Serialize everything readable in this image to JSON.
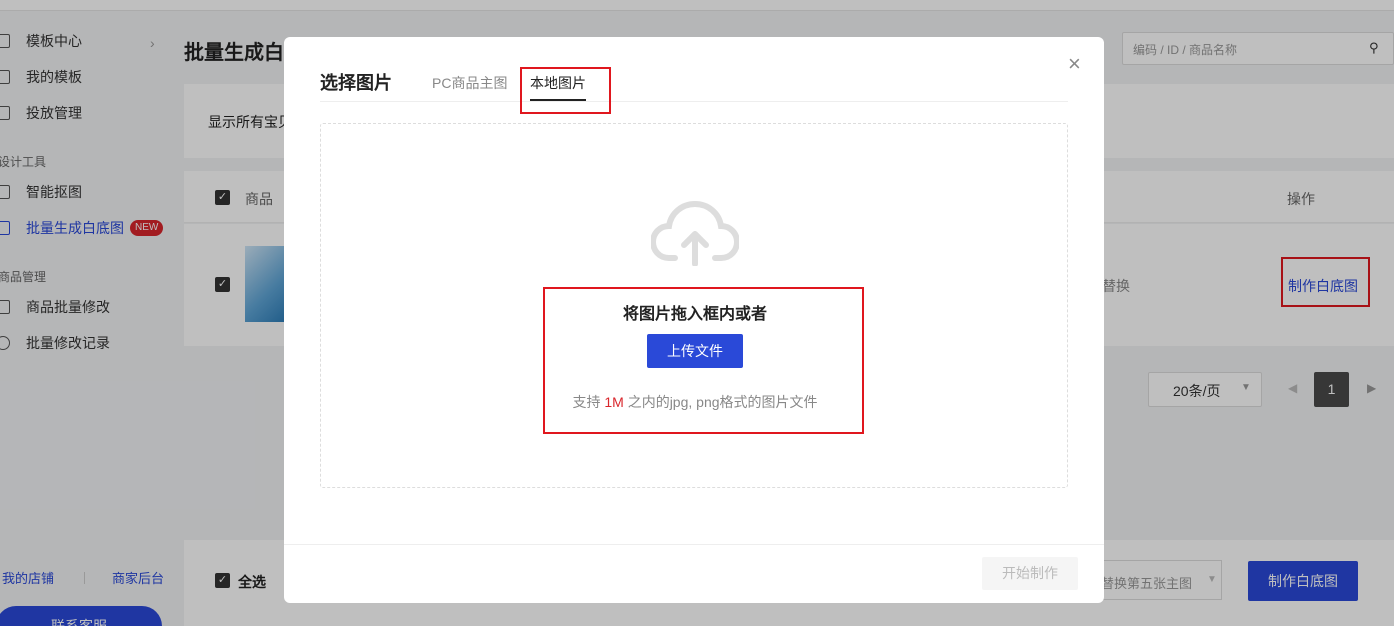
{
  "sidebar": {
    "items": [
      {
        "label": "模板中心",
        "icon": "grid-icon"
      },
      {
        "label": "我的模板",
        "icon": "folder-icon"
      },
      {
        "label": "投放管理",
        "icon": "deliver-icon"
      }
    ],
    "group_design": "设计工具",
    "design_items": [
      {
        "label": "智能抠图",
        "icon": "cutout-icon"
      },
      {
        "label": "批量生成白底图",
        "icon": "white-bg-icon",
        "badge": "NEW"
      }
    ],
    "group_goods": "商品管理",
    "goods_items": [
      {
        "label": "商品批量修改",
        "icon": "bag-icon"
      },
      {
        "label": "批量修改记录",
        "icon": "clock-icon"
      }
    ],
    "link_shop": "我的店铺",
    "link_backend": "商家后台",
    "service_label": "联系客服"
  },
  "main": {
    "page_title": "批量生成白",
    "search_placeholder": "编码 / ID / 商品名称",
    "filter_text": "显示所有宝贝",
    "th_product": "商品",
    "th_operation": "操作",
    "row_replace": "替换",
    "row_make": "制作白底图",
    "page_size": "20条/页",
    "page_current": "1",
    "select_all": "全选",
    "footer_select": "替换第五张主图",
    "footer_make": "制作白底图"
  },
  "modal": {
    "title": "选择图片",
    "tabs": [
      "PC商品主图",
      "本地图片"
    ],
    "close": "×",
    "drop_title": "将图片拖入框内或者",
    "upload_label": "上传文件",
    "hint_prefix": "支持 ",
    "hint_size": "1M",
    "hint_suffix": " 之内的jpg, png格式的图片文件",
    "start_label": "开始制作"
  },
  "colors": {
    "accent": "#2a49d8",
    "highlight": "#e0171e"
  }
}
